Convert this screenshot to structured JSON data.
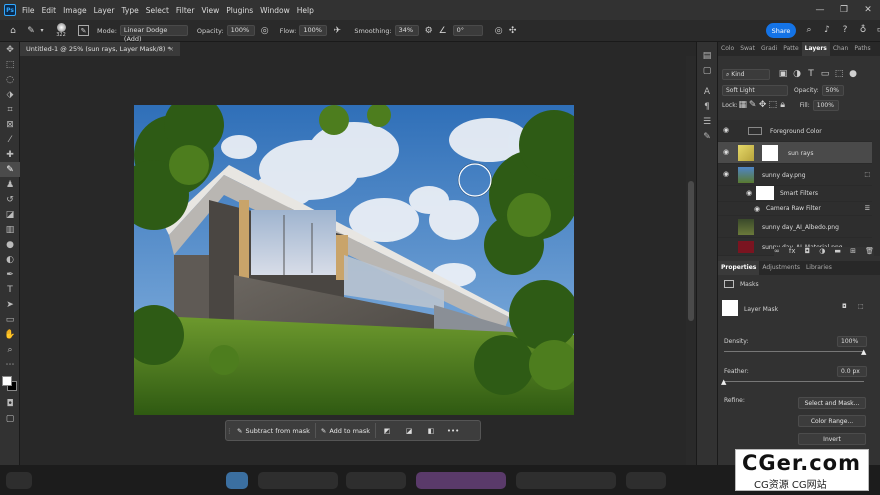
{
  "menu": [
    "File",
    "Edit",
    "Image",
    "Layer",
    "Type",
    "Select",
    "Filter",
    "View",
    "Plugins",
    "Window",
    "Help"
  ],
  "options": {
    "brush_size": "322",
    "mode_label": "Mode:",
    "mode_value": "Linear Dodge (Add)",
    "opacity_label": "Opacity:",
    "opacity_value": "100%",
    "flow_label": "Flow:",
    "flow_value": "100%",
    "smoothing_label": "Smoothing:",
    "smoothing_value": "34%",
    "angle_value": "0°",
    "share_label": "Share"
  },
  "document": {
    "tab_title": "Untitled-1 @ 25% (sun rays, Layer Mask/8) *",
    "close_glyph": "×"
  },
  "context_bar": {
    "subtract_label": "Subtract from mask",
    "add_label": "Add to mask",
    "more_label": "•••"
  },
  "panels": {
    "top_tabs": [
      "Colo",
      "Swat",
      "Gradi",
      "Patte",
      "Layers",
      "Chan",
      "Paths"
    ],
    "active_tab": "Layers",
    "kind_label": "Kind",
    "blend_mode": "Soft Light",
    "opacity_label": "Opacity:",
    "opacity_value": "50%",
    "lock_label": "Lock:",
    "fill_label": "Fill:",
    "fill_value": "100%",
    "layers": [
      {
        "name": "Foreground Color"
      },
      {
        "name": "sun rays"
      },
      {
        "name": "sunny day.png"
      },
      {
        "name": "Smart Filters"
      },
      {
        "name": "Camera Raw Filter"
      },
      {
        "name": "sunny day_AI_Albedo.png"
      },
      {
        "name": "sunny day_AI_Material.png"
      }
    ],
    "props_tabs": [
      "Properties",
      "Adjustments",
      "Libraries"
    ],
    "masks_label": "Masks",
    "layer_mask_label": "Layer Mask",
    "density_label": "Density:",
    "density_value": "100%",
    "density_level": 1.0,
    "feather_label": "Feather:",
    "feather_value": "0.0 px",
    "feather_level": 0.0,
    "refine_label": "Refine:",
    "buttons": [
      "Select and Mask...",
      "Color Range...",
      "Invert"
    ]
  },
  "watermark": {
    "line1": "CGer.com",
    "line2": "CG资源 CG网站"
  },
  "colors": {
    "accent": "#1473e6",
    "panel": "#323232",
    "canvas_bg": "#282828"
  }
}
